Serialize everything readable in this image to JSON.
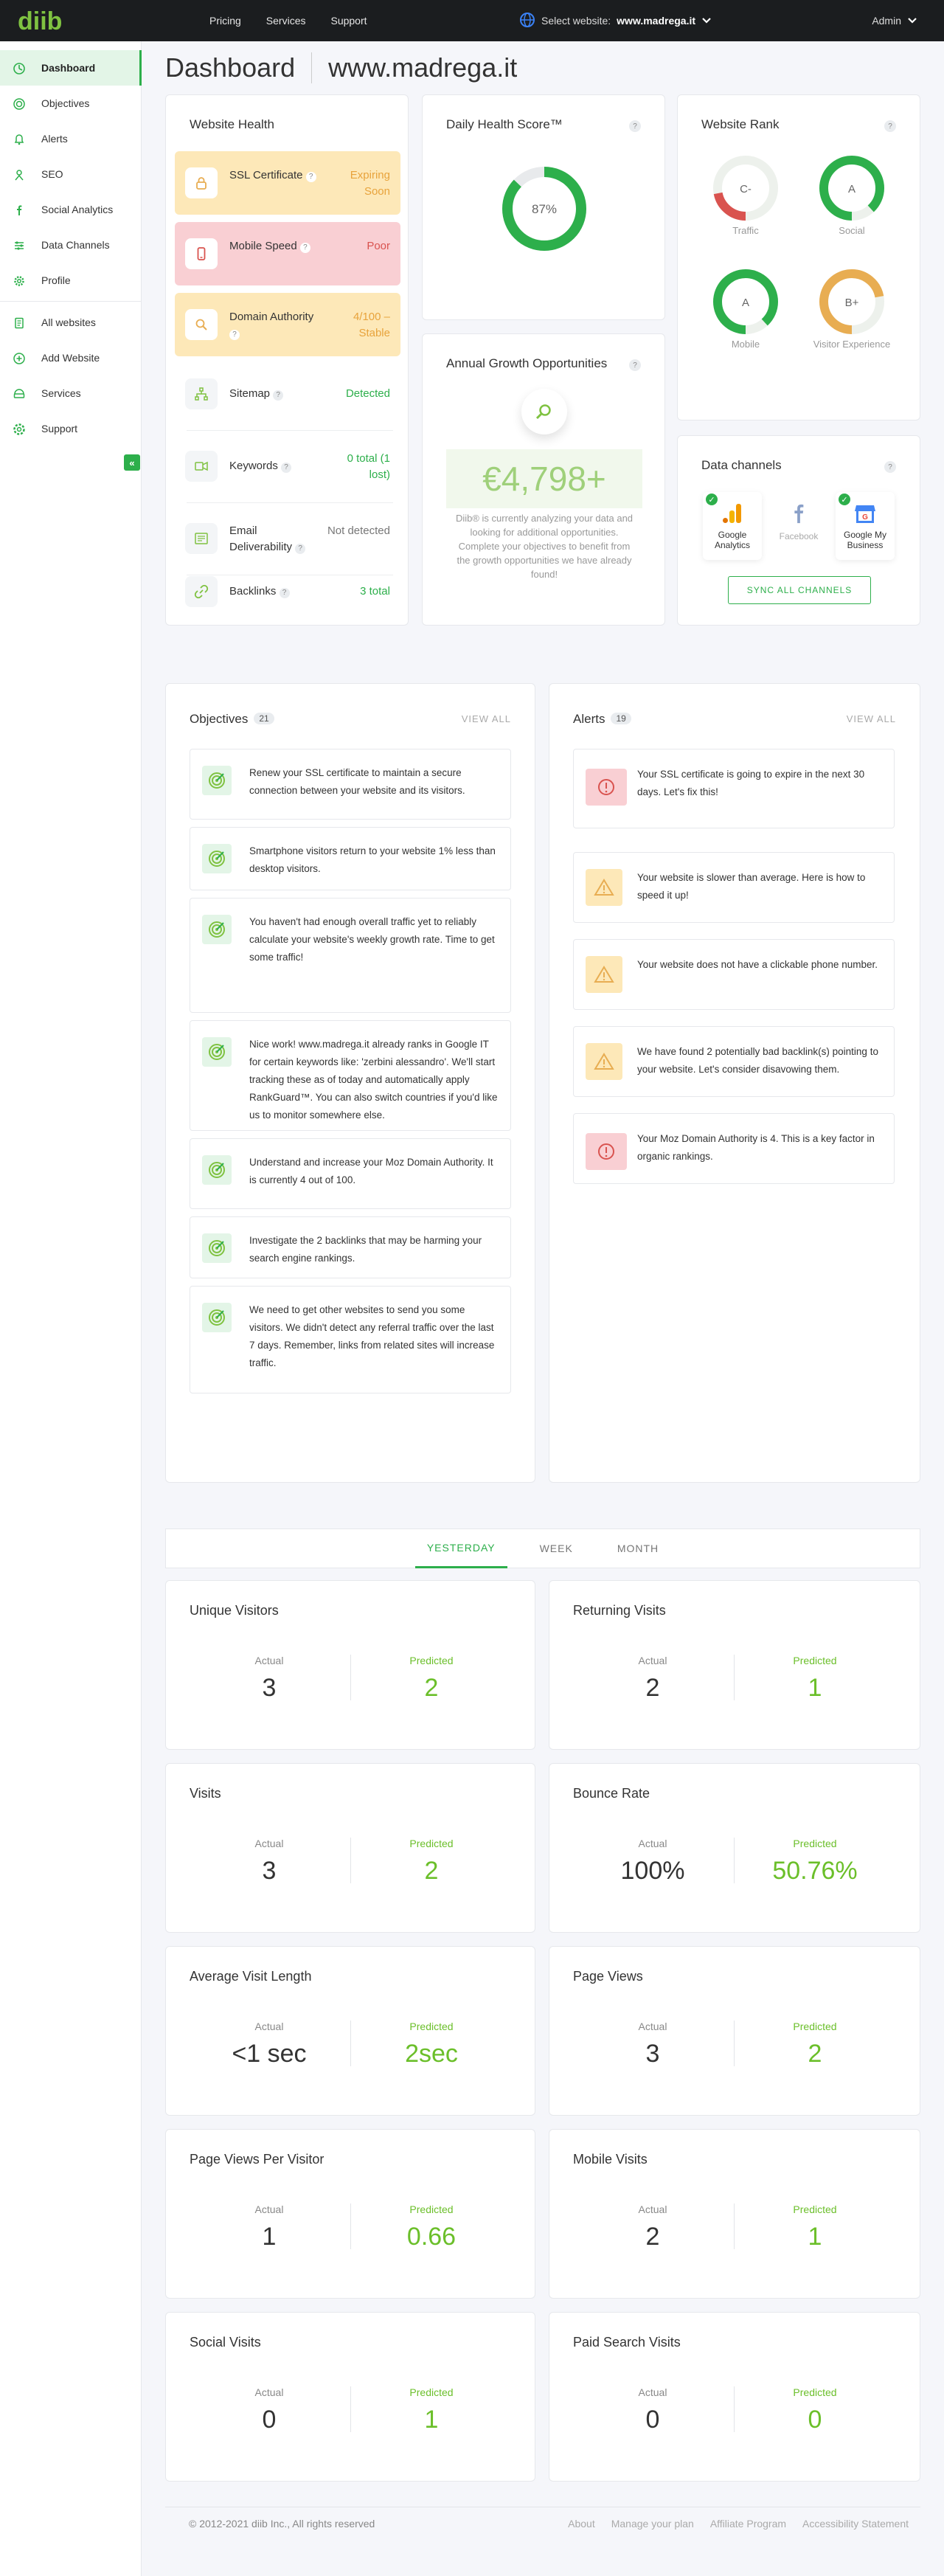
{
  "header": {
    "logo_text": "diib",
    "nav": [
      "Pricing",
      "Services",
      "Support"
    ],
    "site_label": "Select website:",
    "site_value": "www.madrega.it",
    "admin": "Admin"
  },
  "sidebar": {
    "items": [
      {
        "label": "Dashboard",
        "icon": "dashboard-icon",
        "active": true
      },
      {
        "label": "Objectives",
        "icon": "target-icon"
      },
      {
        "label": "Alerts",
        "icon": "bell-icon"
      },
      {
        "label": "SEO",
        "icon": "seo-icon"
      },
      {
        "label": "Social Analytics",
        "icon": "facebook-icon"
      },
      {
        "label": "Data Channels",
        "icon": "data-channels-icon"
      },
      {
        "label": "Profile",
        "icon": "gear-icon"
      }
    ],
    "items2": [
      {
        "label": "All websites",
        "icon": "websites-icon"
      },
      {
        "label": "Add Website",
        "icon": "plus-circle-icon"
      },
      {
        "label": "Services",
        "icon": "services-icon"
      },
      {
        "label": "Support",
        "icon": "support-icon"
      }
    ],
    "collapse_label": "«"
  },
  "page": {
    "title": "Dashboard",
    "site": "www.madrega.it"
  },
  "health": {
    "title": "Website Health",
    "rows": [
      {
        "label": "SSL Certificate",
        "value": "Expiring Soon",
        "tone": "warn"
      },
      {
        "label": "Mobile Speed",
        "value": "Poor",
        "tone": "bad"
      },
      {
        "label": "Domain Authority",
        "value": "4/100 – Stable",
        "tone": "warn"
      },
      {
        "label": "Sitemap",
        "value": "Detected",
        "tone": "ok"
      },
      {
        "label": "Keywords",
        "value": "0 total (1 lost)",
        "tone": "ok"
      },
      {
        "label": "Email Deliverability",
        "value": "Not detected",
        "tone": "neutral"
      },
      {
        "label": "Backlinks",
        "value": "3 total",
        "tone": "ok"
      }
    ]
  },
  "daily": {
    "title": "Daily Health Score™",
    "value": "87%",
    "percent": 87
  },
  "growth": {
    "title": "Annual Growth Opportunities",
    "amount": "€4,798+",
    "text": "Diib® is currently analyzing your data and looking for additional opportunities. Complete your objectives to benefit from the growth opportunities we have already found!"
  },
  "rank": {
    "title": "Website Rank",
    "items": [
      {
        "grade": "C-",
        "label": "Traffic",
        "fill": 0.22,
        "color": "#d9534f"
      },
      {
        "grade": "A",
        "label": "Social",
        "fill": 0.88,
        "color": "#2daf4b"
      },
      {
        "grade": "A",
        "label": "Mobile",
        "fill": 0.88,
        "color": "#2daf4b"
      },
      {
        "grade": "B+",
        "label": "Visitor Experience",
        "fill": 0.72,
        "color": "#e8ad52"
      }
    ]
  },
  "channels": {
    "title": "Data channels",
    "items": [
      {
        "label": "Google Analytics",
        "connected": true
      },
      {
        "label": "Facebook",
        "connected": false
      },
      {
        "label": "Google My Business",
        "connected": true
      }
    ],
    "sync": "SYNC ALL CHANNELS"
  },
  "objectives": {
    "title": "Objectives",
    "count": "21",
    "view_all": "VIEW ALL",
    "items": [
      "Renew your SSL certificate to maintain a secure connection between your website and its visitors.",
      "Smartphone visitors return to your website 1% less than desktop visitors.",
      "You haven't had enough overall traffic yet to reliably calculate your website's weekly growth rate. Time to get some traffic!",
      "Nice work! www.madrega.it already ranks in Google IT for certain keywords like: 'zerbini alessandro'. We'll start tracking these as of today and automatically apply RankGuard™. You can also switch countries if you'd like us to monitor somewhere else.",
      "Understand and increase your Moz Domain Authority. It is currently 4 out of 100.",
      "Investigate the 2 backlinks that may be harming your search engine rankings.",
      "We need to get other websites to send you some visitors. We didn't detect any referral traffic over the last 7 days. Remember, links from related sites will increase traffic."
    ]
  },
  "alerts": {
    "title": "Alerts",
    "count": "19",
    "view_all": "VIEW ALL",
    "items": [
      {
        "text": "Your SSL certificate is going to expire in the next 30 days. Let's fix this!",
        "level": "error"
      },
      {
        "text": "Your website is slower than average. Here is how to speed it up!",
        "level": "warning"
      },
      {
        "text": "Your website does not have a clickable phone number.",
        "level": "warning"
      },
      {
        "text": "We have found 2 potentially bad backlink(s) pointing to your website. Let's consider disavowing them.",
        "level": "warning"
      },
      {
        "text": "Your Moz Domain Authority is 4. This is a key factor in organic rankings.",
        "level": "error"
      }
    ]
  },
  "period_tabs": [
    "YESTERDAY",
    "WEEK",
    "MONTH"
  ],
  "metric_labels": {
    "actual": "Actual",
    "predicted": "Predicted"
  },
  "metrics": [
    {
      "title": "Unique Visitors",
      "actual": "3",
      "predicted": "2"
    },
    {
      "title": "Returning Visits",
      "actual": "2",
      "predicted": "1"
    },
    {
      "title": "Visits",
      "actual": "3",
      "predicted": "2"
    },
    {
      "title": "Bounce Rate",
      "actual": "100%",
      "predicted": "50.76%"
    },
    {
      "title": "Average Visit Length",
      "actual": "<1 sec",
      "predicted": "2sec"
    },
    {
      "title": "Page Views",
      "actual": "3",
      "predicted": "2"
    },
    {
      "title": "Page Views Per Visitor",
      "actual": "1",
      "predicted": "0.66"
    },
    {
      "title": "Mobile Visits",
      "actual": "2",
      "predicted": "1"
    },
    {
      "title": "Social Visits",
      "actual": "0",
      "predicted": "1"
    },
    {
      "title": "Paid Search Visits",
      "actual": "0",
      "predicted": "0"
    }
  ],
  "footer": {
    "copyright": "© 2012-2021 diib Inc., All rights reserved",
    "links": [
      "About",
      "Manage your plan",
      "Affiliate Program",
      "Accessibility Statement"
    ]
  },
  "colors": {
    "brand": "#2daf4b",
    "warn_bg": "#fde8b8",
    "bad_bg": "#f9cfd3",
    "predicted": "#6bbf2a"
  }
}
